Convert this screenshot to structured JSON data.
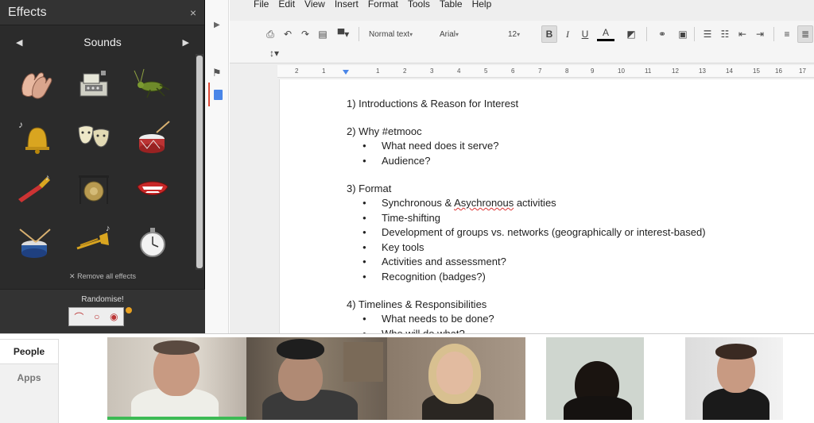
{
  "effects_panel": {
    "title": "Effects",
    "close": "×",
    "prev": "◀",
    "next": "▶",
    "category": "Sounds",
    "items": [
      "clapping-hands",
      "cash-register",
      "cricket",
      "bell",
      "theater-masks",
      "drum",
      "trumpet",
      "gong",
      "laughing-mouth",
      "drum-and-sticks",
      "trombone",
      "stopwatch"
    ],
    "remove_all": "✕ Remove all effects",
    "randomise_label": "Randomise!"
  },
  "docs": {
    "menu": [
      "File",
      "Edit",
      "View",
      "Insert",
      "Format",
      "Tools",
      "Table",
      "Help"
    ],
    "toolbar": {
      "style": "Normal text",
      "font": "Arial",
      "size": "12",
      "bold": "B",
      "italic": "I",
      "underline": "U",
      "text_color": "A"
    },
    "ruler": [
      "2",
      "1",
      "1",
      "2",
      "3",
      "4",
      "5",
      "6",
      "7",
      "8",
      "9",
      "10",
      "11",
      "12",
      "13",
      "14",
      "15",
      "16",
      "17"
    ],
    "content": {
      "s1": "1) Introductions & Reason for Interest",
      "s2": "2) Why #etmooc",
      "s2_b1": "What need does it serve?",
      "s2_b2": "Audience?",
      "s3": "3) Format",
      "s3_b1_a": "Synchronous & ",
      "s3_b1_b": "Asychronous",
      "s3_b1_c": " activities",
      "s3_b2": "Time-shifting",
      "s3_b3": "Development of groups vs. networks (geographically or interest-based)",
      "s3_b4": "Key tools",
      "s3_b5": "Activities and assessment?",
      "s3_b6": "Recognition (badges?)",
      "s4": "4) Timelines & Responsibilities",
      "s4_b1": "What needs to be done?",
      "s4_b2": "Who will do what?"
    }
  },
  "hangout": {
    "tab_people": "People",
    "tab_apps": "Apps"
  },
  "colors": {
    "panel_bg": "#2b2b2b",
    "active_speaker": "#3cba54",
    "spellcheck": "#dd3333"
  }
}
